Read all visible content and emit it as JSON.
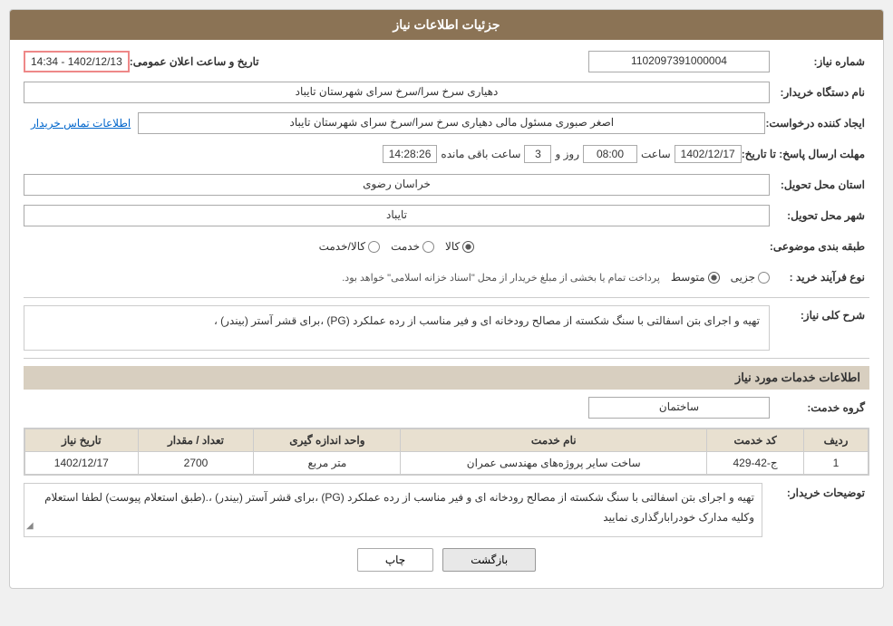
{
  "header": {
    "title": "جزئیات اطلاعات نیاز"
  },
  "fields": {
    "need_number_label": "شماره نیاز:",
    "need_number_value": "1102097391000004",
    "date_label": "تاریخ و ساعت اعلان عمومی:",
    "date_value": "1402/12/13 - 14:34",
    "buyer_name_label": "نام دستگاه خریدار:",
    "buyer_name_value": "دهیاری سرخ سرا/سرخ سرای  شهرستان تایباد",
    "creator_label": "ایجاد کننده درخواست:",
    "creator_value": "اصغر صبوری مسئول مالی دهیاری سرخ سرا/سرخ سرای  شهرستان تایباد",
    "contact_link": "اطلاعات تماس خریدار",
    "reply_deadline_label": "مهلت ارسال پاسخ: تا تاریخ:",
    "reply_date": "1402/12/17",
    "reply_time_label": "ساعت",
    "reply_time": "08:00",
    "reply_days_label": "روز و",
    "reply_days": "3",
    "reply_remaining_label": "ساعت باقی مانده",
    "reply_remaining": "14:28:26",
    "province_label": "استان محل تحویل:",
    "province_value": "خراسان رضوی",
    "city_label": "شهر محل تحویل:",
    "city_value": "تایباد",
    "category_label": "طبقه بندی موضوعی:",
    "category_options": [
      "کالا",
      "خدمت",
      "کالا/خدمت"
    ],
    "category_selected": "کالا",
    "process_label": "نوع فرآیند خرید :",
    "process_options": [
      "جزیی",
      "متوسط"
    ],
    "process_note": "پرداخت تمام یا بخشی از مبلغ خریدار از محل \"اسناد خزانه اسلامی\" خواهد بود.",
    "need_desc_section": "شرح کلی نیاز:",
    "need_desc_value": "تهیه و اجرای بتن  اسفالتی با سنگ شکسته از مصالح رودخانه ای و فیر مناسب از رده عملکرد (PG) ،برای قشر آستر (بیندر) ،",
    "services_section": "اطلاعات خدمات مورد نیاز",
    "service_group_label": "گروه خدمت:",
    "service_group_value": "ساختمان"
  },
  "table": {
    "columns": [
      "ردیف",
      "کد خدمت",
      "نام خدمت",
      "واحد اندازه گیری",
      "تعداد / مقدار",
      "تاریخ نیاز"
    ],
    "rows": [
      {
        "row_num": "1",
        "service_code": "ج-42-429",
        "service_name": "ساخت سایر پروژه‌های مهندسی عمران",
        "unit": "متر مربع",
        "quantity": "2700",
        "date": "1402/12/17"
      }
    ]
  },
  "buyer_desc_label": "توضیحات خریدار:",
  "buyer_desc_value": "تهیه و اجرای بتن  اسفالتی با سنگ شکسته از مصالح رودخانه ای و فیر مناسب از رده عملکرد (PG) ،برای قشر آستر (بیندر) ،.(طبق استعلام پیوست) لطفا استعلام وکلیه مدارک خودرابارگذاری نمایید",
  "buttons": {
    "back_label": "بازگشت",
    "print_label": "چاپ"
  }
}
